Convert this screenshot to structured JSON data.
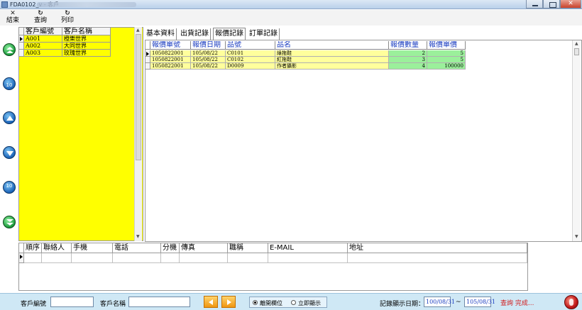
{
  "window": {
    "title": "FDA0102_v - 客戶"
  },
  "toolbar": {
    "items": [
      {
        "label": "結束",
        "icon": "close-icon"
      },
      {
        "label": "查詢",
        "icon": "refresh-icon"
      },
      {
        "label": "列印",
        "icon": "refresh-icon"
      }
    ]
  },
  "nav": {
    "labels": [
      "10",
      "10"
    ]
  },
  "customers": {
    "columns": [
      "客戶編號",
      "客戶名稱"
    ],
    "rows": [
      [
        "A001",
        "橙樂世界"
      ],
      [
        "A002",
        "大同世界"
      ],
      [
        "A003",
        "玫瑰世界"
      ]
    ],
    "panel_color": "#ffff00"
  },
  "tabs": [
    "基本資料",
    "出貨記錄",
    "報價記錄",
    "訂單記錄"
  ],
  "active_tab": 2,
  "quotes": {
    "columns": [
      "報價單號",
      "報價日期",
      "品號",
      "品名",
      "報價數量",
      "報價單價"
    ],
    "rows": [
      [
        "1050822001",
        "105/08/22",
        "C0101",
        "綠拖鞋",
        "2",
        "5"
      ],
      [
        "1050822001",
        "105/08/22",
        "C0102",
        "紅拖鞋",
        "3",
        "5"
      ],
      [
        "1050822001",
        "105/08/22",
        "D0009",
        "作者攝影",
        "4",
        "100000"
      ]
    ],
    "header_color": "#1a3cc0",
    "row_color": "#ffff9c",
    "number_color": "#9bf09b"
  },
  "contacts": {
    "columns": [
      "順序",
      "聯絡人",
      "手機",
      "電話",
      "分機",
      "傳真",
      "職稱",
      "E-MAIL",
      "地址"
    ]
  },
  "statusbar": {
    "customer_id_label": "客戶編號",
    "customer_id_value": "",
    "customer_name_label": "客戶名稱",
    "customer_name_value": "",
    "radio_leave": "離開欄位",
    "radio_instant": "立即顯示",
    "date_label": "記錄顯示日期：",
    "date_from": "100/08/31",
    "date_sep": "~",
    "date_to": "105/08/31",
    "status": "查詢 完成...",
    "status_color": "#d21a1a"
  }
}
